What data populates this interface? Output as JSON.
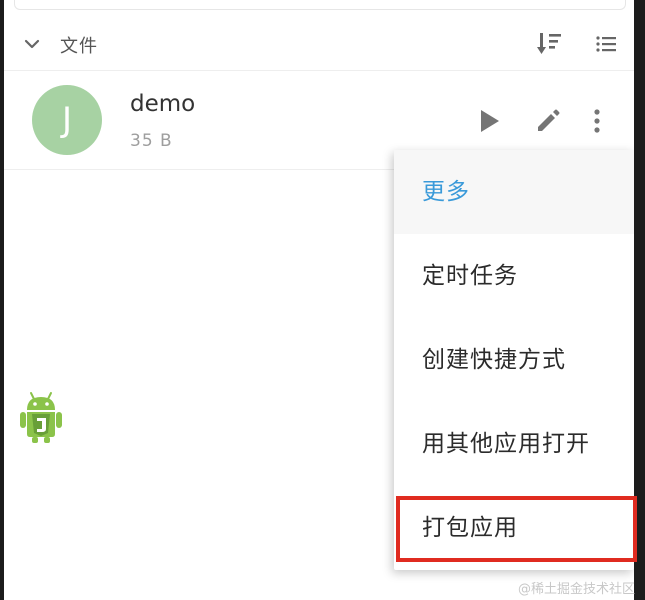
{
  "section": {
    "title": "文件"
  },
  "file": {
    "avatar_letter": "J",
    "name": "demo",
    "size": "35 B"
  },
  "menu": {
    "header": "更多",
    "items": [
      "定时任务",
      "创建快捷方式",
      "用其他应用打开",
      "打包应用"
    ]
  },
  "watermark": "@稀土掘金技术社区",
  "colors": {
    "accent": "#3a9ad9",
    "avatar": "#a7d2a3",
    "highlight": "#e02b20",
    "android_green": "#8bc34a"
  },
  "icons": {
    "collapse": "chevron-down-icon",
    "sort": "sort-icon",
    "list": "list-view-icon",
    "run": "play-icon",
    "edit": "pencil-icon",
    "more": "more-vertical-icon",
    "app": "android-js-logo-icon"
  }
}
